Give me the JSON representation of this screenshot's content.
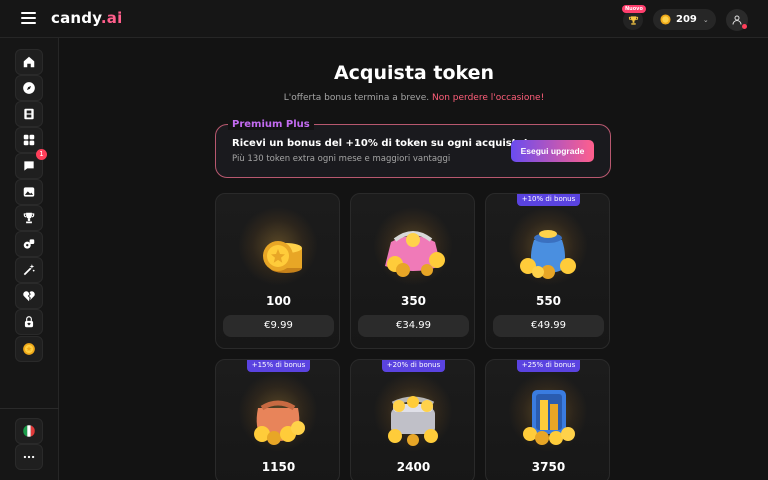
{
  "header": {
    "logo_main": "candy",
    "logo_suffix": ".ai",
    "new_badge": "Nuovo",
    "token_balance": "209",
    "accent_color": "#ff5f8c"
  },
  "sidebar": {
    "items": [
      {
        "icon": "home-icon"
      },
      {
        "icon": "compass-icon"
      },
      {
        "icon": "film-icon"
      },
      {
        "icon": "grid-icon"
      },
      {
        "icon": "chat-icon",
        "badge": "1"
      },
      {
        "icon": "image-gallery-icon"
      },
      {
        "icon": "trophy-icon"
      },
      {
        "icon": "gift-icon"
      },
      {
        "icon": "magic-wand-icon"
      },
      {
        "icon": "broken-heart-icon"
      },
      {
        "icon": "lock-heart-icon"
      },
      {
        "icon": "coin-icon"
      }
    ],
    "bottom": [
      {
        "icon": "italy-flag-icon"
      },
      {
        "icon": "more-dots-icon"
      }
    ]
  },
  "main": {
    "title": "Acquista token",
    "subtitle": "L'offerta bonus termina a breve.",
    "subtitle_highlight": "Non perdere l'occasione!"
  },
  "premium": {
    "tag": "Premium Plus",
    "headline": "Ricevi un bonus del +10% di token su ogni acquisto!",
    "subtext": "Più 130 token extra ogni mese e maggiori vantaggi",
    "button": "Esegui upgrade"
  },
  "packs": [
    {
      "amount": "100",
      "price": "€9.99",
      "bonus": null,
      "icon": "coin-stack-icon"
    },
    {
      "amount": "350",
      "price": "€34.99",
      "bonus": null,
      "icon": "coin-purse-icon"
    },
    {
      "amount": "550",
      "price": "€49.99",
      "bonus": "+10% di bonus",
      "icon": "coin-bag-icon"
    },
    {
      "amount": "1150",
      "price": "",
      "bonus": "+15% di bonus",
      "icon": "coin-sack-icon"
    },
    {
      "amount": "2400",
      "price": "",
      "bonus": "+20% di bonus",
      "icon": "coin-chest-icon"
    },
    {
      "amount": "3750",
      "price": "",
      "bonus": "+25% di bonus",
      "icon": "coin-vault-icon"
    }
  ]
}
